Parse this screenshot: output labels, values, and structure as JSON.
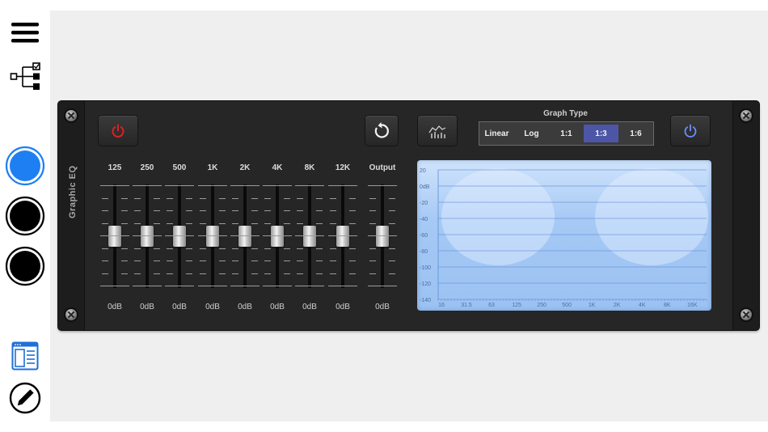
{
  "sidebar": {
    "menu_icon": "hamburger-menu-icon",
    "tree_icon": "routing-tree-icon",
    "color_circles": [
      {
        "name": "color-circle-blue",
        "color": "#1e7ff2",
        "selected": true
      },
      {
        "name": "color-circle-black-1",
        "color": "#000000",
        "selected": false
      },
      {
        "name": "color-circle-black-2",
        "color": "#000000",
        "selected": false
      }
    ],
    "layout_icon": "window-layout-icon",
    "edit_icon": "pencil-edit-icon"
  },
  "device": {
    "title": "Graphic EQ",
    "power_left_icon": "power-icon",
    "power_left_color": "#e02020",
    "reset_icon": "refresh-icon",
    "graph_toggle_icon": "eq-graph-icon",
    "power_right_icon": "power-icon",
    "power_right_color": "#6b8fff",
    "graph_type": {
      "label": "Graph Type",
      "options": [
        "Linear",
        "Log",
        "1:1",
        "1:3",
        "1:6"
      ],
      "selected": "1:3"
    },
    "bands": [
      {
        "label": "125",
        "value": "0dB"
      },
      {
        "label": "250",
        "value": "0dB"
      },
      {
        "label": "500",
        "value": "0dB"
      },
      {
        "label": "1K",
        "value": "0dB"
      },
      {
        "label": "2K",
        "value": "0dB"
      },
      {
        "label": "4K",
        "value": "0dB"
      },
      {
        "label": "8K",
        "value": "0dB"
      },
      {
        "label": "12K",
        "value": "0dB"
      }
    ],
    "output": {
      "label": "Output",
      "value": "0dB"
    },
    "graph": {
      "y_labels": [
        "20",
        "0dB",
        "-20",
        "-40",
        "-60",
        "-80",
        "-100",
        "-120",
        "-140"
      ],
      "x_labels": [
        "16",
        "31.5",
        "63",
        "125",
        "250",
        "500",
        "1K",
        "2K",
        "4K",
        "8K",
        "16K"
      ]
    }
  }
}
